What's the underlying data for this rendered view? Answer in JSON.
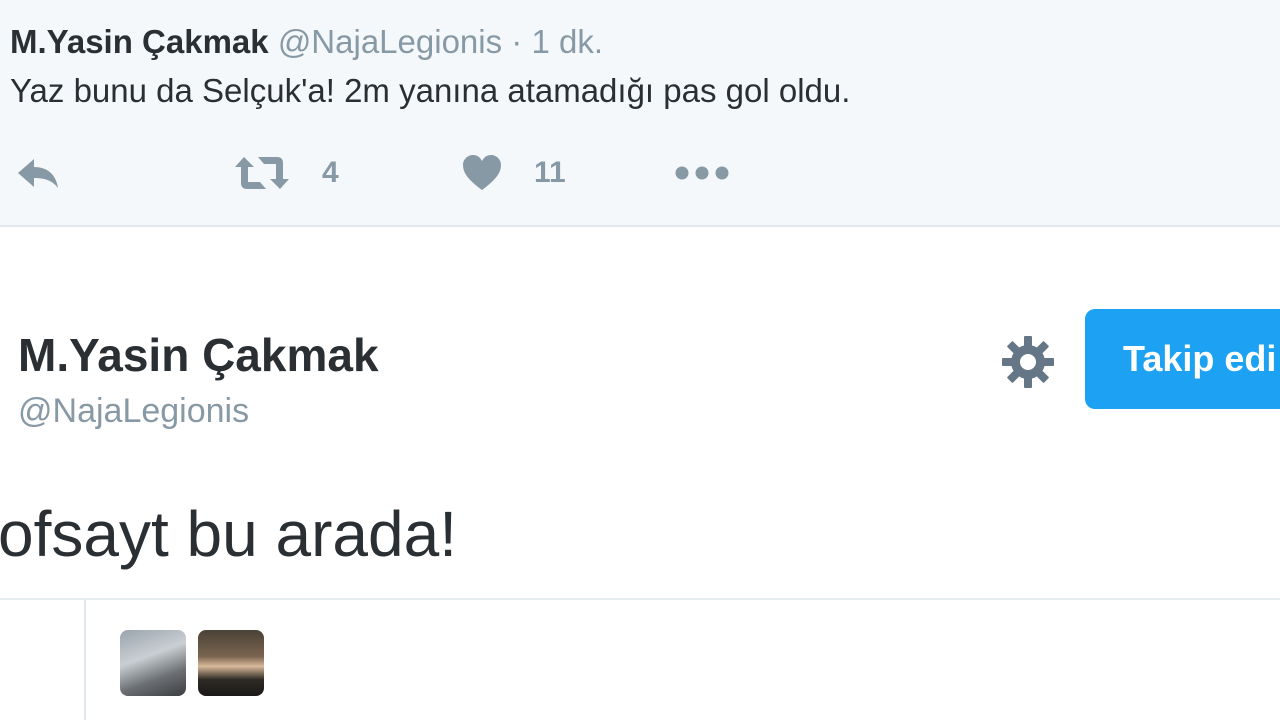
{
  "top_tweet": {
    "name": "M.Yasin Çakmak",
    "handle": "@NajaLegionis",
    "dot": "·",
    "time": "1 dk.",
    "text": "Yaz bunu da Selçuk'a! 2m yanına atamadığı pas gol oldu.",
    "actions": {
      "reply_icon": "reply-icon",
      "retweet_icon": "retweet-icon",
      "retweet_count": "4",
      "like_icon": "heart-icon",
      "like_count": "11",
      "more_icon": "more-dots-icon"
    }
  },
  "main_tweet": {
    "name": "M.Yasin Çakmak",
    "handle": "@NajaLegionis",
    "settings_icon": "gear-icon",
    "follow_label": "Takip edi",
    "text": "ofsayt bu arada!"
  },
  "colors": {
    "accent": "#1da1f2",
    "muted": "#8899a6",
    "text": "#292f33",
    "top_bg": "#f5f8fa"
  }
}
